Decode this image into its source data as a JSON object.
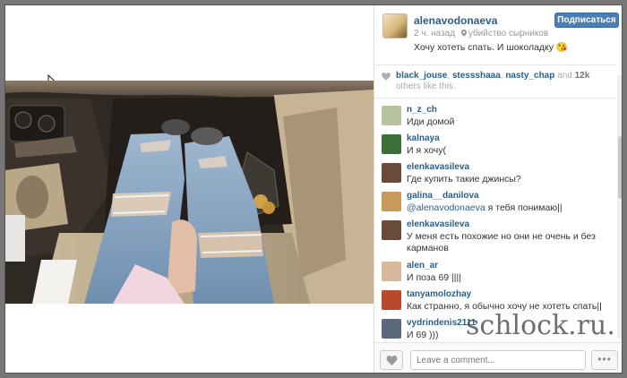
{
  "post": {
    "username": "alenavodonaeva",
    "follow_label": "Подписаться",
    "time_ago": "2 ч. назад",
    "location": "убийство сырников",
    "caption": "Хочу хотеть спать. И шоколадку 😘"
  },
  "likes": {
    "users": [
      "black_jouse",
      "stessshaaa",
      "nasty_chap"
    ],
    "conj": "and",
    "count": "12k",
    "suffix": "others like this."
  },
  "comments": [
    {
      "user": "n_z_ch",
      "text": "Иди домой",
      "avatar": "#b8c4a0"
    },
    {
      "user": "kalnaya",
      "text": "И я хочу(",
      "avatar": "#3c6e3a"
    },
    {
      "user": "elenkavasileva",
      "text": "Где купить такие джинсы?",
      "avatar": "#6a4a3a"
    },
    {
      "user": "galina__danilova",
      "mention": "@alenavodonaeva",
      "text": "я тебя понимаю||",
      "avatar": "#c89a5a"
    },
    {
      "user": "elenkavasileva",
      "text": "У меня есть похожие но они не очень и без карманов",
      "avatar": "#6a4a3a"
    },
    {
      "user": "alen_ar",
      "text": "И поза 69 ||||",
      "avatar": "#d8b89a"
    },
    {
      "user": "tanyamolozhay",
      "text": "Как странно, я обычно хочу не хотеть спать||",
      "avatar": "#b84a2a"
    },
    {
      "user": "vydrindenis2111",
      "text": "И 69 )))",
      "avatar": "#5a6a7a"
    }
  ],
  "footer": {
    "comment_placeholder": "Leave a comment...",
    "more_label": "•••"
  },
  "watermark": "schlock.ru.",
  "icons": {
    "cursor": "cursor-arrow-icon",
    "location": "location-pin-icon",
    "heart": "heart-icon",
    "more": "more-dots-icon"
  },
  "colors": {
    "link": "#2e5e86",
    "follow_button": "#4a7fb5",
    "muted": "#999999"
  }
}
